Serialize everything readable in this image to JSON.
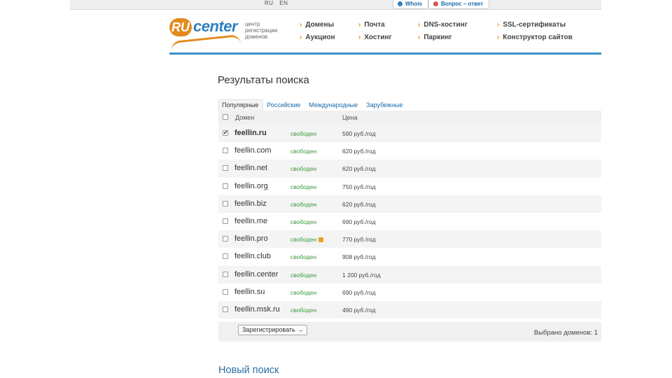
{
  "topbar": {
    "languages": [
      "RU",
      "EN"
    ],
    "whois_label": "Whois",
    "qa_label": "Вопрос – ответ"
  },
  "header": {
    "logo_ru": "RU",
    "logo_center": "center",
    "logo_subtitle": "центр регистрации доменов",
    "nav": [
      "Домены",
      "Почта",
      "DNS-хостинг",
      "SSL-сертификаты",
      "Аукцион",
      "Хостинг",
      "Паркинг",
      "Конструктор сайтов"
    ]
  },
  "main": {
    "title": "Результаты поиска",
    "tabs": [
      "Популярные",
      "Российские",
      "Международные",
      "Зарубежные"
    ],
    "active_tab": "Популярные",
    "columns": [
      "Домен",
      "Цена"
    ],
    "rows": [
      {
        "domain": "feellin.ru",
        "status": "свободен",
        "price": "590 руб./год",
        "checked": true
      },
      {
        "domain": "feellin.com",
        "status": "свободен",
        "price": "620 руб./год",
        "checked": false
      },
      {
        "domain": "feellin.net",
        "status": "свободен",
        "price": "620 руб./год",
        "checked": false
      },
      {
        "domain": "feellin.org",
        "status": "свободен",
        "price": "750 руб./год",
        "checked": false
      },
      {
        "domain": "feellin.biz",
        "status": "свободен",
        "price": "620 руб./год",
        "checked": false
      },
      {
        "domain": "feellin.me",
        "status": "свободен",
        "price": "690 руб./год",
        "checked": false
      },
      {
        "domain": "feellin.pro",
        "status": "свободен",
        "price": "770 руб./год",
        "checked": false
      },
      {
        "domain": "feellin.club",
        "status": "свободен",
        "price": "908 руб./год",
        "checked": false
      },
      {
        "domain": "feellin.center",
        "status": "свободен",
        "price": "1 200 руб./год",
        "checked": false
      },
      {
        "domain": "feellin.su",
        "status": "свободен",
        "price": "690 руб./год",
        "checked": false
      },
      {
        "domain": "feellin.msk.ru",
        "status": "свободен",
        "price": "490 руб./год",
        "checked": false
      }
    ],
    "register_button": "Зарегистрировать →",
    "selected_count": "Выбрано доменов: 1",
    "new_search": "Новый поиск"
  },
  "colors": {
    "accent_blue": "#2f7fbf",
    "accent_orange": "#e38a1b",
    "status_green": "#3a9a3a"
  }
}
